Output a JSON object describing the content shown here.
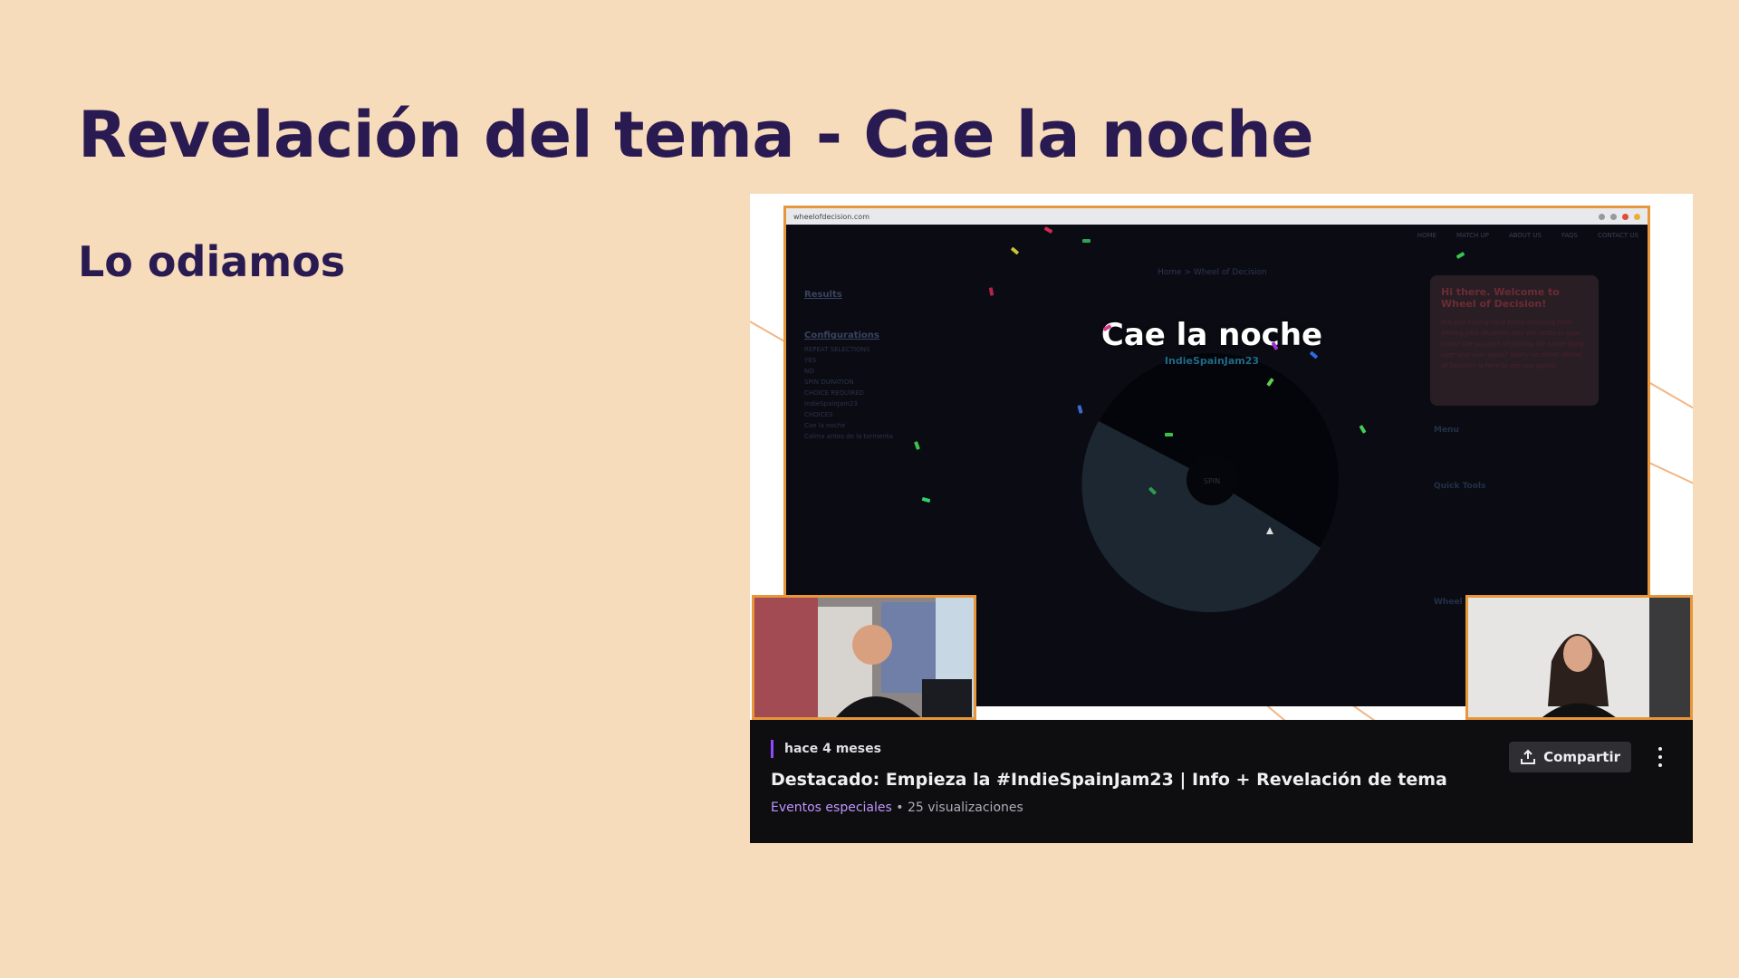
{
  "slide": {
    "title": "Revelación del tema - Cae la noche",
    "subtitle": "Lo odiamos"
  },
  "video": {
    "screen": {
      "url": "wheelofdecision.com",
      "nav": [
        "HOME",
        "MATCH UP",
        "ABOUT US",
        "FAQS",
        "CONTACT US"
      ],
      "breadcrumb": "Home  >  Wheel of Decision",
      "left_panel": {
        "results_heading": "Results",
        "config_heading": "Configurations",
        "repeat_label": "REPEAT SELECTIONS",
        "yes": "YES",
        "no": "NO",
        "spin_duration": "SPIN DURATION",
        "wheel_name_label": "CHOICE REQUIRED",
        "wheel_name": "IndieSpainJam23",
        "choices_label": "CHOICES",
        "choice_1": "Cae la noche",
        "choice_2": "Calma antes de la tormenta"
      },
      "wheel_title": "Cae la noche",
      "wheel_subtitle": "IndieSpainJam23",
      "spin_label": "SPIN",
      "welcome_title": "Hi there. Welcome to Wheel of Decision!",
      "welcome_text": "Are you having hard times choosing from among your students who will recite in your class? Are you sick of picking the same thing over and over again? Worry no more! Wheel of Decision is here to get you going!",
      "menu": "Menu",
      "quick_tools": "Quick Tools",
      "wheel_label": "Wheel"
    },
    "info": {
      "ago": "hace 4 meses",
      "title": "Destacado: Empieza la #IndieSpainJam23 | Info + Revelación de tema",
      "category": "Eventos especiales",
      "separator": " • ",
      "views": "25 visualizaciones",
      "share_label": "Compartir"
    }
  },
  "colors": {
    "background": "#f6dcbb",
    "title": "#2a1a52",
    "accent": "#9147ff",
    "frame_border": "#e8963a"
  }
}
